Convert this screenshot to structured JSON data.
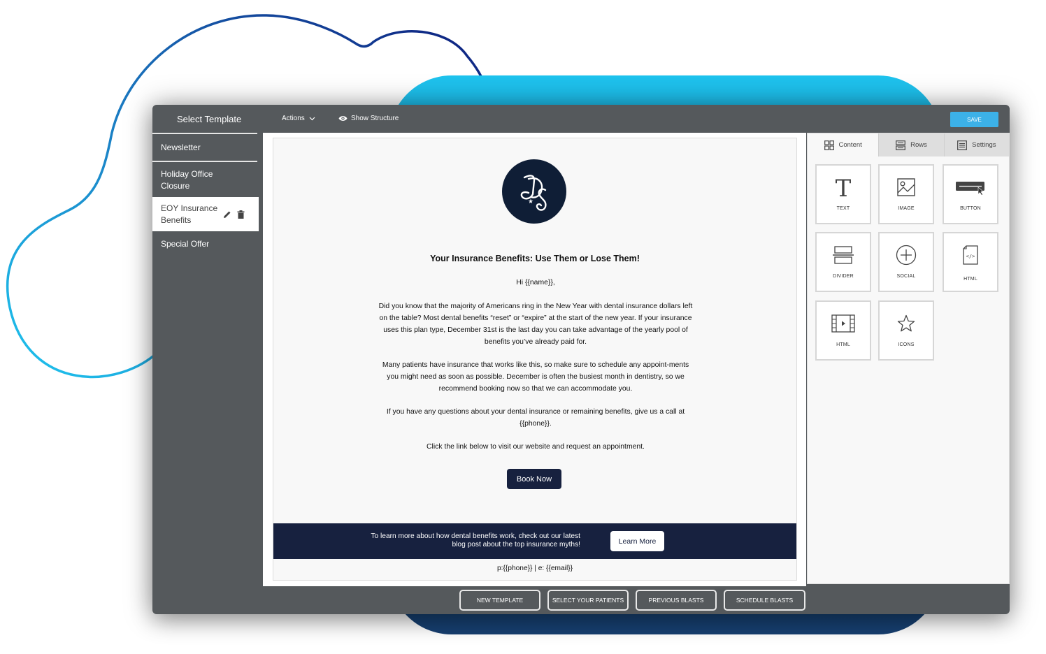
{
  "toolbar": {
    "select_template": "Select Template",
    "actions": "Actions",
    "show_structure": "Show Structure",
    "save": "SAVE"
  },
  "sidebar": {
    "items": [
      {
        "label": "Newsletter"
      },
      {
        "label": "Holiday Office Closure"
      },
      {
        "label": "EOY Insurance Benefits",
        "active": true
      },
      {
        "label": "Special Offer"
      }
    ]
  },
  "email": {
    "logo_text": "DS",
    "title": "Your Insurance Benefits: Use Them or Lose Them!",
    "greeting": "Hi {{name}},",
    "paragraphs": [
      "Did you know that the majority of Americans ring in the New Year with dental insurance dollars left on the table? Most dental benefits “reset” or “expire” at the start of the new year. If your insurance uses this plan type, December 31st is the last day you can take advantage of the yearly pool of benefits you’ve already paid for.",
      "Many patients have insurance that works like this, so make sure to schedule any appoint-ments you might need as soon as possible. December is often the busiest month in dentistry, so we recommend booking now so that we can accommodate you.",
      "If you have any questions about your dental insurance or remaining benefits, give us a call at {{phone}}.",
      "Click the link below to visit our website and request an appointment."
    ],
    "book_button": "Book Now",
    "banner_text": "To learn more about how dental benefits work, check out our latest blog post about the top insurance myths!",
    "learn_button": "Learn More",
    "contact": "p:{{phone}} | e: {{email}}"
  },
  "panel": {
    "tabs": [
      {
        "label": "Content",
        "icon": "grid-icon",
        "active": true
      },
      {
        "label": "Rows",
        "icon": "rows-icon"
      },
      {
        "label": "Settings",
        "icon": "settings-icon"
      }
    ],
    "tiles": [
      {
        "label": "TEXT",
        "icon": "text-icon"
      },
      {
        "label": "IMAGE",
        "icon": "image-icon"
      },
      {
        "label": "BUTTON",
        "icon": "button-icon"
      },
      {
        "label": "DIVIDER",
        "icon": "divider-icon"
      },
      {
        "label": "SOCIAL",
        "icon": "plus-circle-icon"
      },
      {
        "label": "HTML",
        "icon": "code-file-icon"
      },
      {
        "label": "HTML",
        "icon": "video-icon"
      },
      {
        "label": "ICONS",
        "icon": "star-icon"
      }
    ]
  },
  "bottom_bar": {
    "buttons": [
      "NEW TEMPLATE",
      "SELECT YOUR PATIENTS",
      "PREVIOUS BLASTS",
      "SCHEDULE BLASTS"
    ]
  },
  "colors": {
    "app_bg": "#55595c",
    "save": "#3cb1e8",
    "navy": "#17213f",
    "logo_bg": "#0f1e36",
    "blob_top": "#1ec3ee",
    "blob_bottom": "#173f70"
  }
}
